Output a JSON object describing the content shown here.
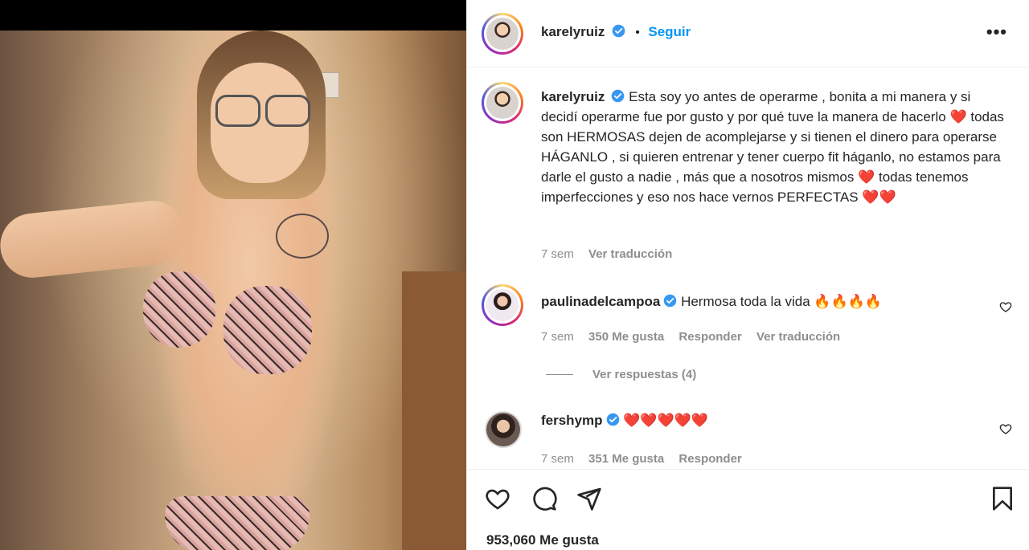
{
  "post": {
    "author": "karelyruiz",
    "follow_label": "Seguir",
    "dot": "•",
    "more": "•••"
  },
  "caption": {
    "author": "karelyruiz",
    "text": "Esta soy yo antes de operarme , bonita a mi manera y si decidí operarme fue por gusto y por qué tuve la manera de hacerlo",
    "text2": "todas son HERMOSAS dejen de acomplejarse y si tienen el dinero para operarse HÁGANLO , si quieren entrenar y tener cuerpo fit háganlo, no estamos para darle el gusto a nadie , más que a nosotros mismos",
    "text3": "todas tenemos imperfecciones y eso nos hace vernos PERFECTAS",
    "heart": "❤️",
    "time": "7 sem",
    "translate": "Ver traducción"
  },
  "comments": [
    {
      "author": "paulinadelcampoa",
      "text": "Hermosa toda la vida 🔥🔥🔥🔥",
      "time": "7 sem",
      "likes": "350 Me gusta",
      "reply": "Responder",
      "translate": "Ver traducción",
      "replies": "Ver respuestas (4)"
    },
    {
      "author": "fershymp",
      "text": "❤️❤️❤️❤️❤️",
      "time": "7 sem",
      "likes": "351 Me gusta",
      "reply": "Responder"
    }
  ],
  "likes_total": "953,060 Me gusta",
  "colors": {
    "link": "#0095f6",
    "muted": "#8e8e8e",
    "text": "#262626",
    "verified": "#3897f0"
  },
  "icons": [
    "heart-icon",
    "comment-icon",
    "share-icon",
    "bookmark-icon",
    "verified-badge-icon",
    "more-options-icon"
  ]
}
